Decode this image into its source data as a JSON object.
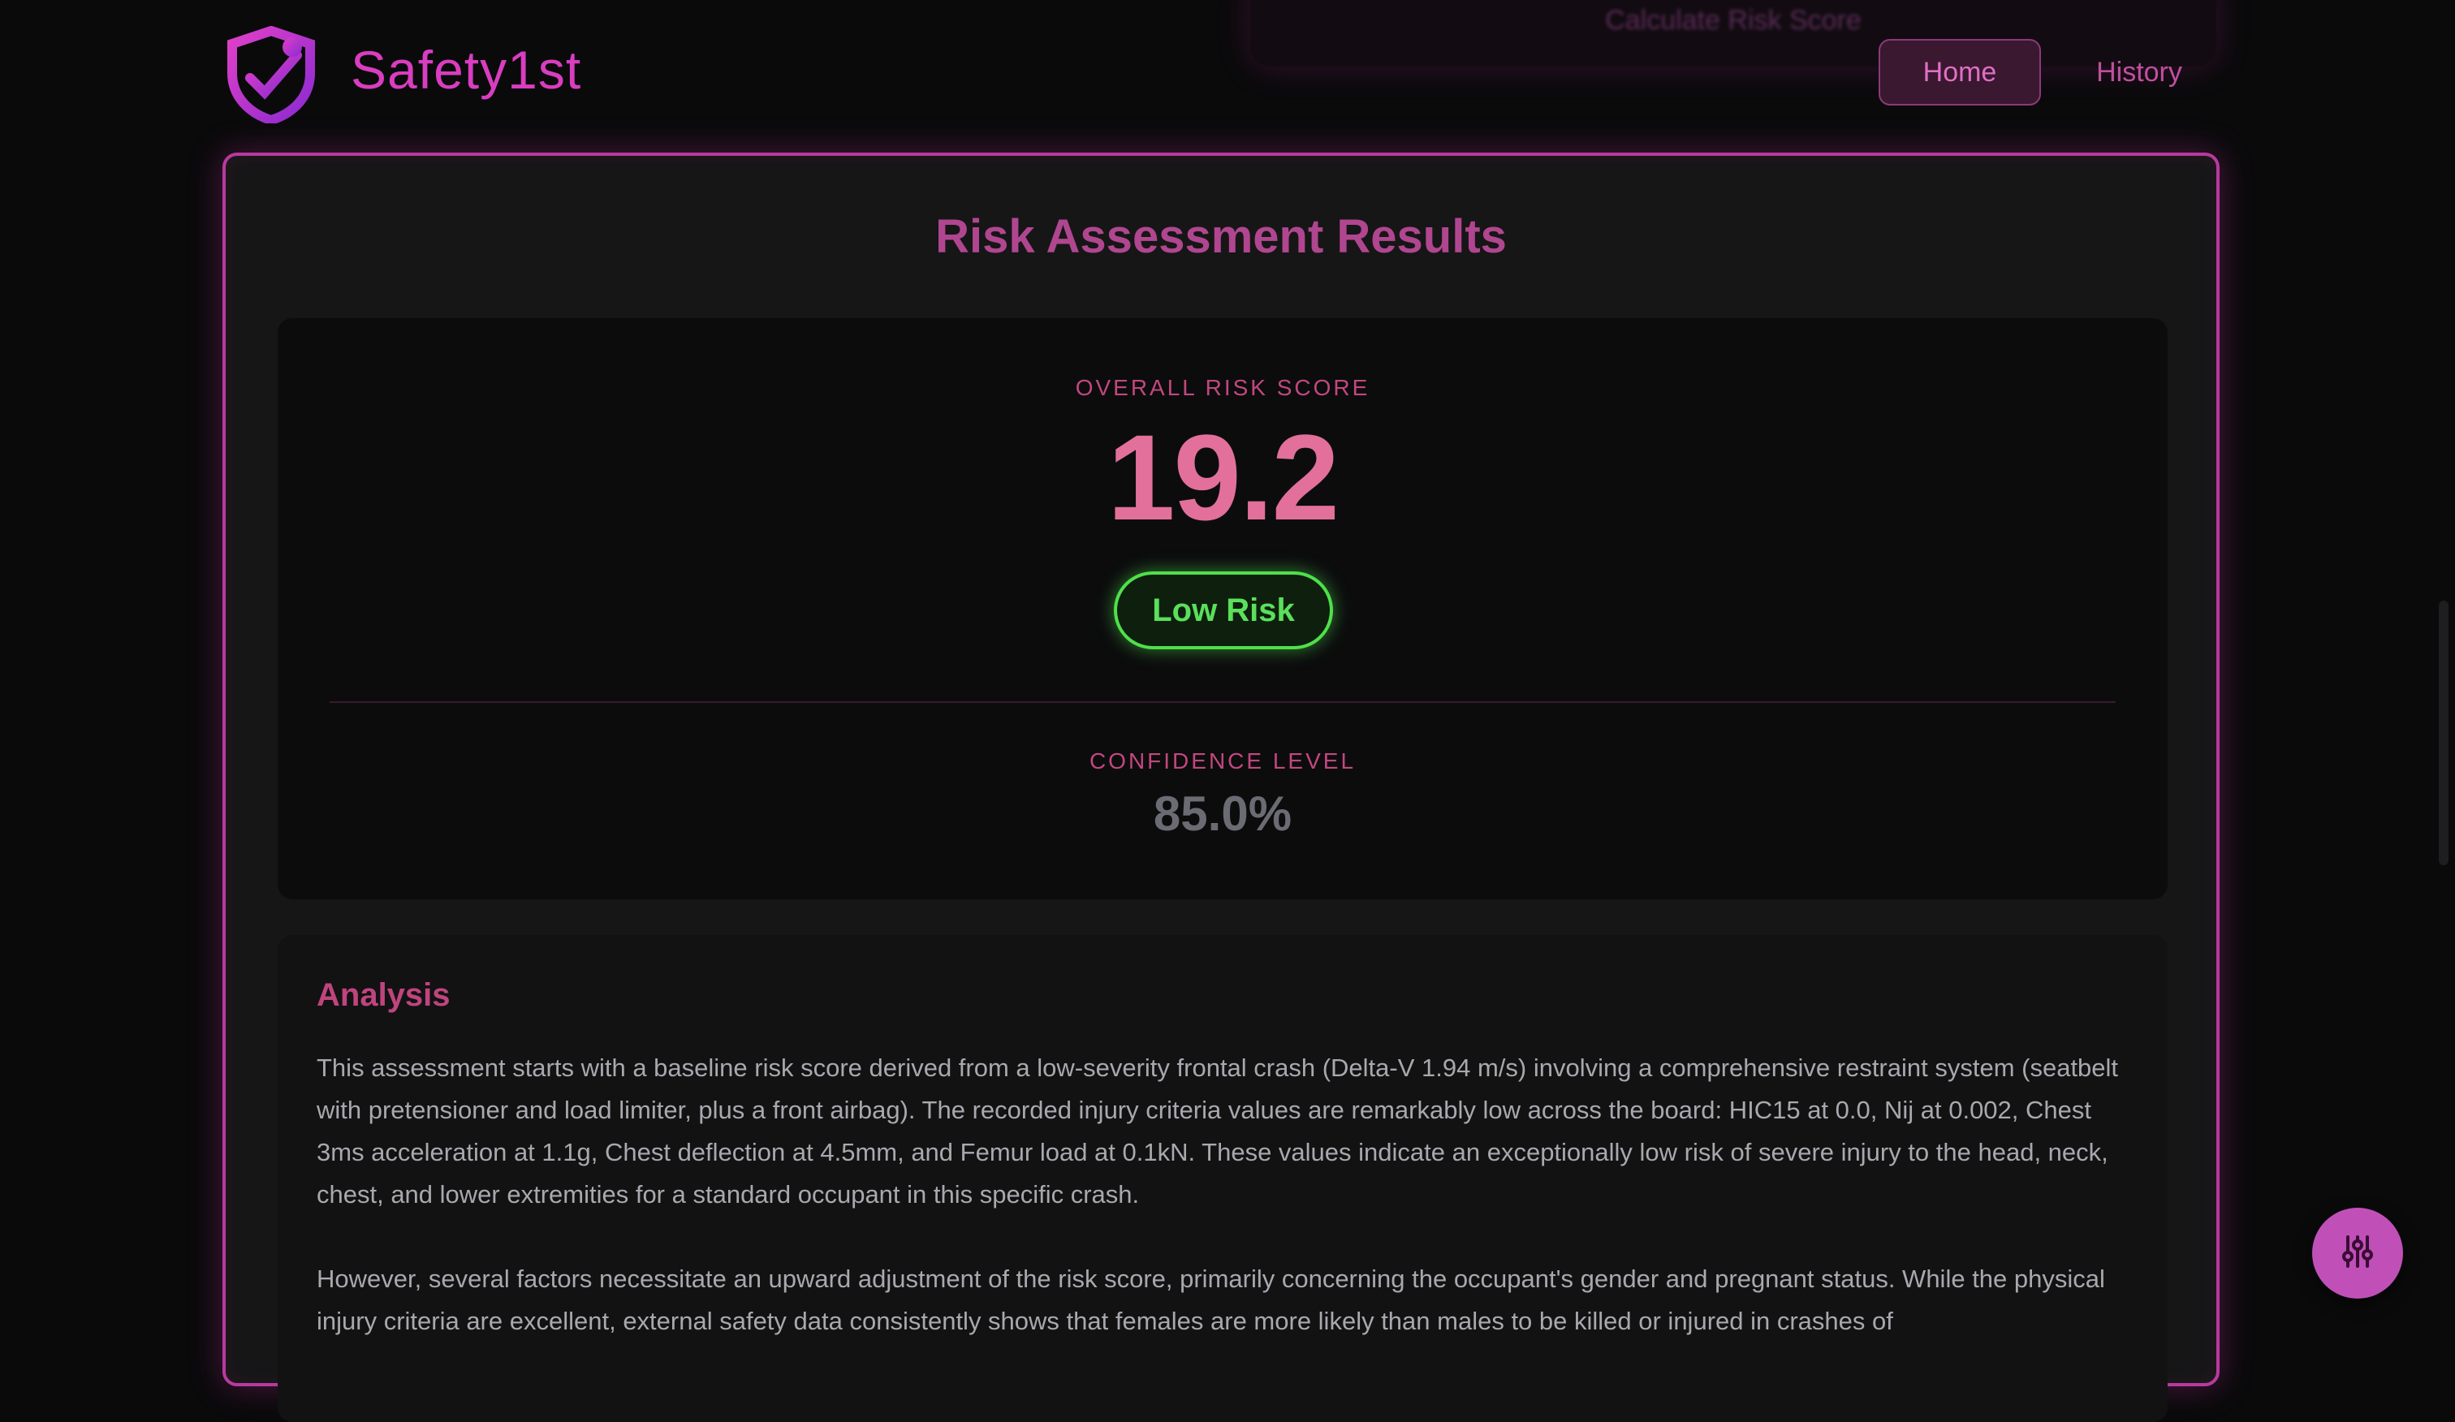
{
  "header": {
    "brand": "Safety1st",
    "ghost_button": "Calculate Risk Score",
    "nav": {
      "home": "Home",
      "history": "History"
    }
  },
  "results": {
    "title": "Risk Assessment Results",
    "score_label": "OVERALL RISK SCORE",
    "score_value": "19.2",
    "risk_level": "Low Risk",
    "confidence_label": "CONFIDENCE LEVEL",
    "confidence_value": "85.0%"
  },
  "analysis": {
    "title": "Analysis",
    "paragraphs": [
      "This assessment starts with a baseline risk score derived from a low-severity frontal crash (Delta-V 1.94 m/s) involving a comprehensive restraint system (seatbelt with pretensioner and load limiter, plus a front airbag). The recorded injury criteria values are remarkably low across the board: HIC15 at 0.0, Nij at 0.002, Chest 3ms acceleration at 1.1g, Chest deflection at 4.5mm, and Femur load at 0.1kN. These values indicate an exceptionally low risk of severe injury to the head, neck, chest, and lower extremities for a standard occupant in this specific crash.",
      "However, several factors necessitate an upward adjustment of the risk score, primarily concerning the occupant's gender and pregnant status. While the physical injury criteria are excellent, external safety data consistently shows that females are more likely than males to be killed or injured in crashes of"
    ]
  },
  "icons": {
    "logo": "shield-wrench-icon",
    "fab": "sliders-icon"
  },
  "colors": {
    "accent": "#d93dc0",
    "low_risk": "#5ae05a",
    "score": "#e2709a"
  }
}
